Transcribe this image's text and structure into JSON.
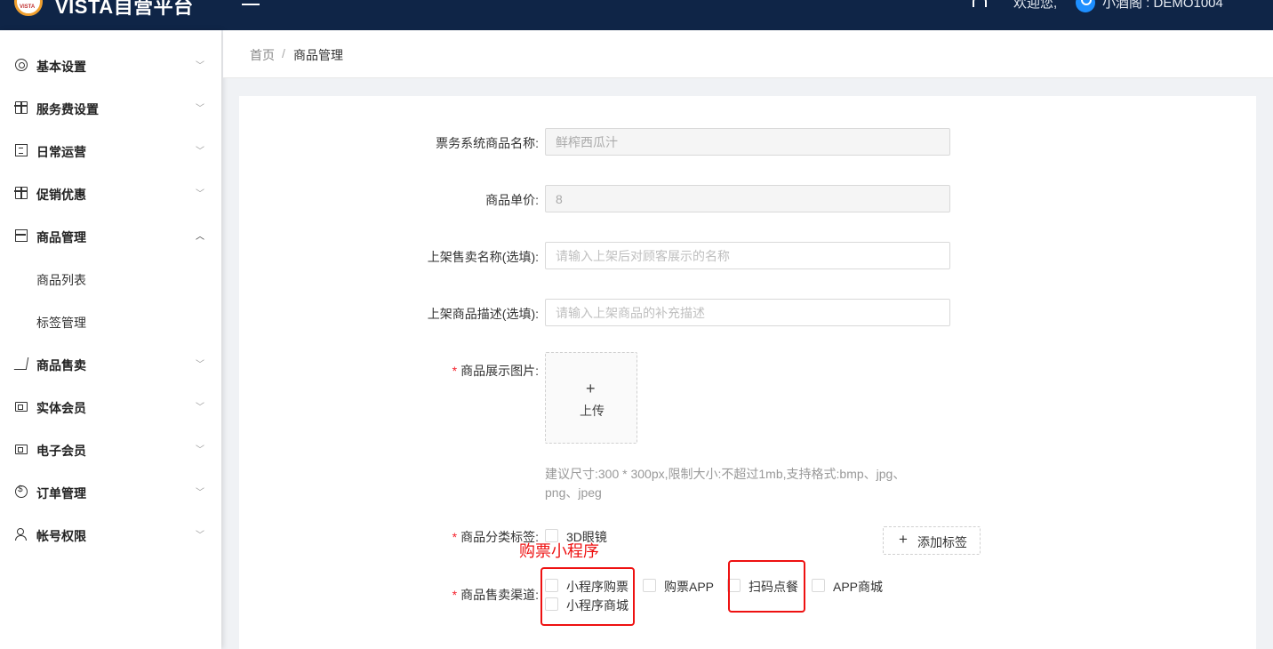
{
  "header": {
    "brand": "VISTA自营平台",
    "welcome": "欢迎您,",
    "user": "小酒阁 : DEMO1004"
  },
  "sidebar": {
    "items": [
      {
        "label": "基本设置",
        "icon": "gear-icon"
      },
      {
        "label": "服务费设置",
        "icon": "gift-icon"
      },
      {
        "label": "日常运营",
        "icon": "document-icon"
      },
      {
        "label": "促销优惠",
        "icon": "gift-icon"
      },
      {
        "label": "商品管理",
        "icon": "store-icon",
        "expanded": true
      },
      {
        "label": "商品售卖",
        "icon": "cart-icon"
      },
      {
        "label": "实体会员",
        "icon": "card-icon"
      },
      {
        "label": "电子会员",
        "icon": "card-icon"
      },
      {
        "label": "订单管理",
        "icon": "coin-icon"
      },
      {
        "label": "帐号权限",
        "icon": "users-icon"
      }
    ],
    "sub_items": [
      "商品列表",
      "标签管理"
    ]
  },
  "breadcrumb": {
    "home": "首页",
    "separator": "/",
    "current": "商品管理"
  },
  "form": {
    "system_name": {
      "label": "票务系统商品名称:",
      "value": "鲜榨西瓜汁"
    },
    "price": {
      "label": "商品单价:",
      "value": "8"
    },
    "sale_name": {
      "label": "上架售卖名称(选填):",
      "placeholder": "请输入上架后对顾客展示的名称"
    },
    "description": {
      "label": "上架商品描述(选填):",
      "placeholder": "请输入上架商品的补充描述"
    },
    "image": {
      "label": "商品展示图片:",
      "required": "*",
      "upload_plus": "+",
      "upload_text": "上传"
    },
    "hint": "建议尺寸:300 * 300px,限制大小:不超过1mb,支持格式:bmp、jpg、png、jpeg",
    "category": {
      "label": "商品分类标签:",
      "required": "*",
      "options": [
        "3D眼镜"
      ],
      "add_button_plus": "+",
      "add_button": "添加标签"
    },
    "channel": {
      "label": "商品售卖渠道:",
      "required": "*",
      "options": [
        "小程序购票",
        "购票APP",
        "扫码点餐",
        "APP商城",
        "小程序商城"
      ]
    }
  },
  "annotation": {
    "text": "购票小程序",
    "color": "#ee1111"
  },
  "colors": {
    "header_bg": "#0f2547",
    "required": "#f5222d"
  }
}
